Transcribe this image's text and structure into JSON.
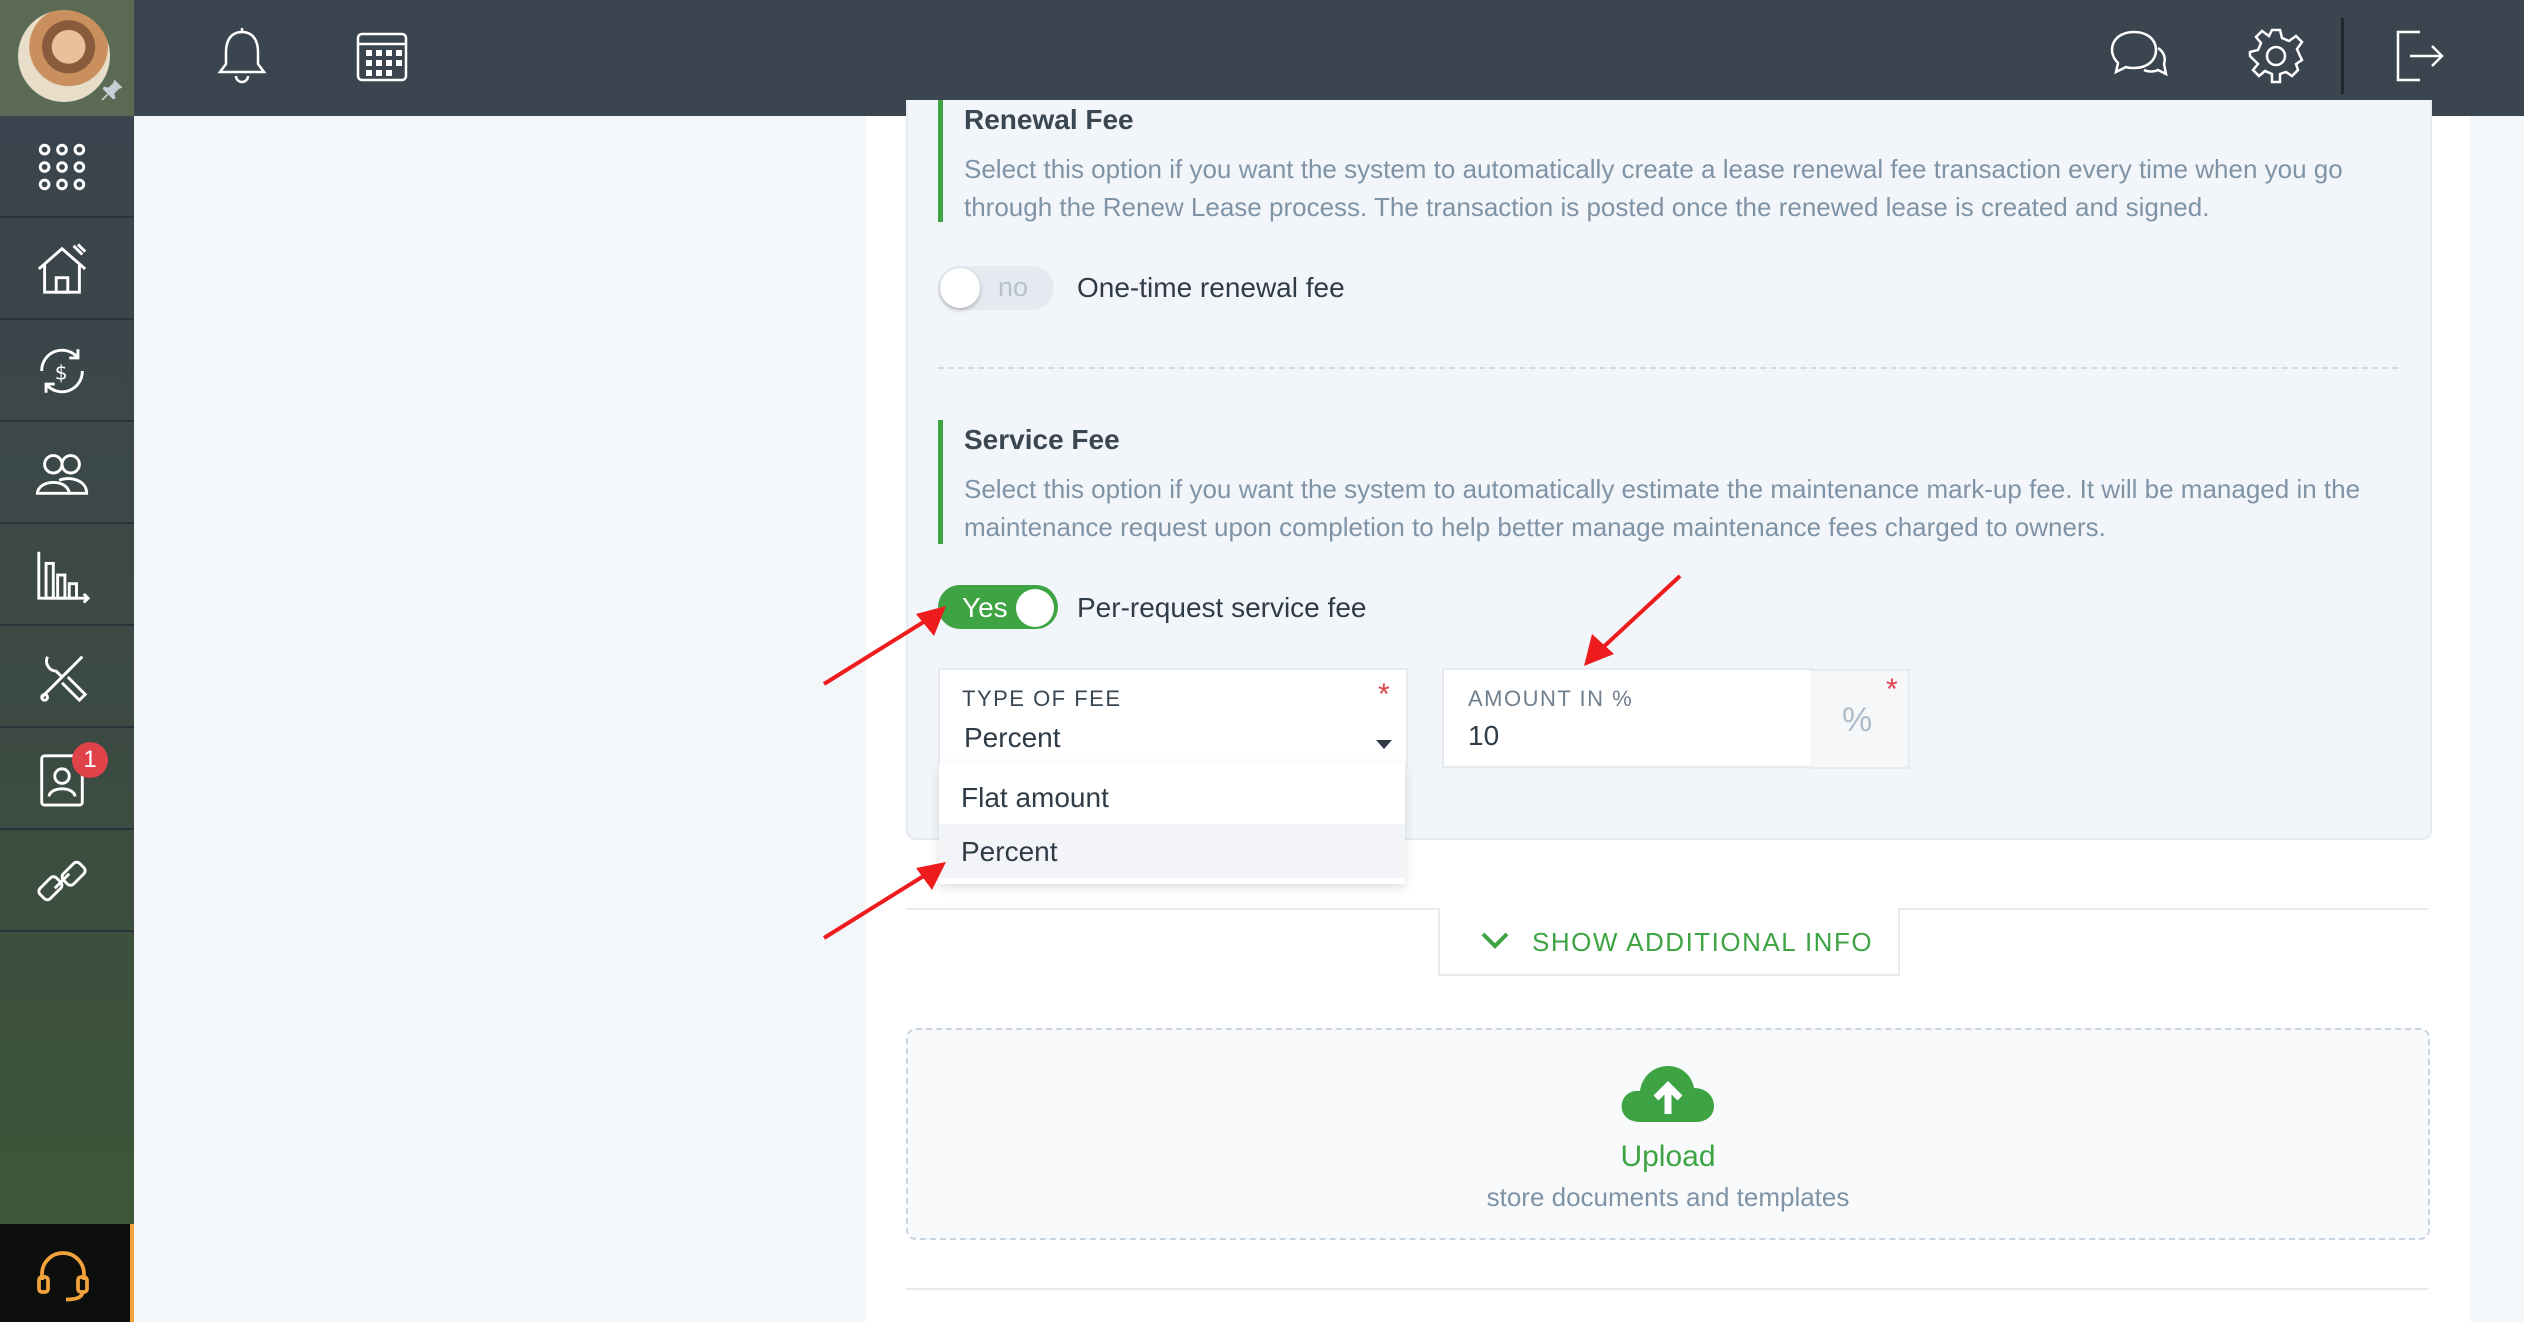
{
  "topbar": {
    "icons": [
      "bell-icon",
      "calendar-icon",
      "chat-icon",
      "gear-icon",
      "logout-icon"
    ]
  },
  "sidebar": {
    "items": [
      {
        "icon": "apps-grid-icon"
      },
      {
        "icon": "properties-icon"
      },
      {
        "icon": "accounting-icon"
      },
      {
        "icon": "people-icon"
      },
      {
        "icon": "reports-icon"
      },
      {
        "icon": "maintenance-icon"
      },
      {
        "icon": "contacts-icon",
        "badge": "1"
      },
      {
        "icon": "integrations-icon"
      }
    ],
    "support_icon": "headset-icon"
  },
  "renewal_fee": {
    "title": "Renewal Fee",
    "description": "Select this option if you want the system to automatically create a lease renewal fee transaction every time when you go through the Renew Lease process. The transaction is posted once the renewed lease is created and signed.",
    "toggle_state": "no",
    "toggle_label": "One-time renewal fee"
  },
  "service_fee": {
    "title": "Service Fee",
    "description": "Select this option if you want the system to automatically estimate the maintenance mark-up fee. It will be managed in the maintenance request upon completion to help better manage maintenance fees charged to owners.",
    "toggle_state": "Yes",
    "toggle_label": "Per-request service fee",
    "type_of_fee": {
      "label": "TYPE OF FEE",
      "required_mark": "*",
      "value": "Percent",
      "options": [
        "Flat amount",
        "Percent"
      ]
    },
    "amount": {
      "label": "AMOUNT IN %",
      "required_mark": "*",
      "value": "10",
      "addon": "%"
    }
  },
  "show_info": {
    "label": "SHOW ADDITIONAL INFO"
  },
  "upload": {
    "title": "Upload",
    "subtitle": "store documents and templates"
  },
  "colors": {
    "accent": "#3ea343",
    "topbar": "#3b4550",
    "badge": "#e0424a",
    "annotation_arrow": "#ee1c1c"
  }
}
